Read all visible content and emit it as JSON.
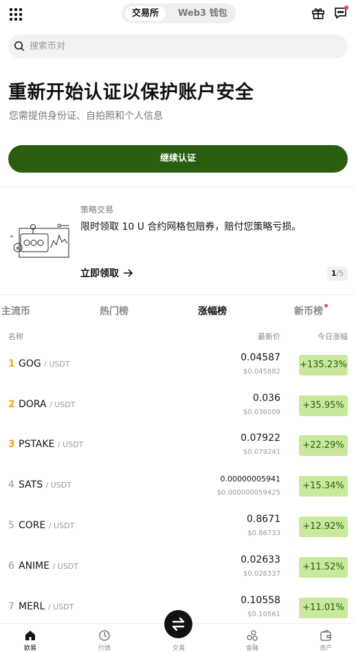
{
  "header": {
    "tabs": [
      {
        "label": "交易所",
        "active": true
      },
      {
        "label": "Web3 钱包",
        "active": false
      }
    ]
  },
  "search": {
    "placeholder": "搜索币对"
  },
  "hero": {
    "title": "重新开始认证以保护账户安全",
    "subtitle": "您需提供身份证、自拍照和个人信息",
    "cta_label": "继续认证"
  },
  "promo": {
    "tag": "策略交易",
    "text": "限时领取 10 U 合约网格包赔券，赔付您策略亏损。",
    "link_label": "立即领取",
    "pager_current": "1",
    "pager_total": "/5"
  },
  "market_tabs": [
    {
      "label": "主流币",
      "active": false
    },
    {
      "label": "热门榜",
      "active": false
    },
    {
      "label": "涨幅榜",
      "active": true
    },
    {
      "label": "新币榜",
      "active": false,
      "dot": true
    }
  ],
  "columns": {
    "name": "名称",
    "price": "最新价",
    "change": "今日涨幅"
  },
  "rows": [
    {
      "rank": "1",
      "base": "GOG",
      "quote": "/ USDT",
      "price": "0.04587",
      "fiat": "$0.045882",
      "change": "+135.23%"
    },
    {
      "rank": "2",
      "base": "DORA",
      "quote": "/ USDT",
      "price": "0.036",
      "fiat": "$0.036009",
      "change": "+35.95%"
    },
    {
      "rank": "3",
      "base": "PSTAKE",
      "quote": "/ USDT",
      "price": "0.07922",
      "fiat": "$0.079241",
      "change": "+22.29%"
    },
    {
      "rank": "4",
      "base": "SATS",
      "quote": "/ USDT",
      "price": "0.00000005941",
      "fiat": "$0.000000059425",
      "change": "+15.34%"
    },
    {
      "rank": "5",
      "base": "CORE",
      "quote": "/ USDT",
      "price": "0.8671",
      "fiat": "$0.86733",
      "change": "+12.92%"
    },
    {
      "rank": "6",
      "base": "ANIME",
      "quote": "/ USDT",
      "price": "0.02633",
      "fiat": "$0.026337",
      "change": "+11.52%"
    },
    {
      "rank": "7",
      "base": "MERL",
      "quote": "/ USDT",
      "price": "0.10558",
      "fiat": "$0.10561",
      "change": "+11.01%"
    }
  ],
  "bottom_nav": [
    {
      "label": "欧易",
      "icon": "home-icon",
      "active": true
    },
    {
      "label": "行情",
      "icon": "market-icon",
      "active": false
    },
    {
      "label": "交易",
      "icon": "swap-icon",
      "active": false
    },
    {
      "label": "金融",
      "icon": "finance-icon",
      "active": false
    },
    {
      "label": "资产",
      "icon": "wallet-icon",
      "active": false
    }
  ],
  "colors": {
    "primary": "#2a5d10",
    "gain_bg": "#c8e89c",
    "rank_top": "#f5a70a",
    "badge": "#e5484d"
  }
}
